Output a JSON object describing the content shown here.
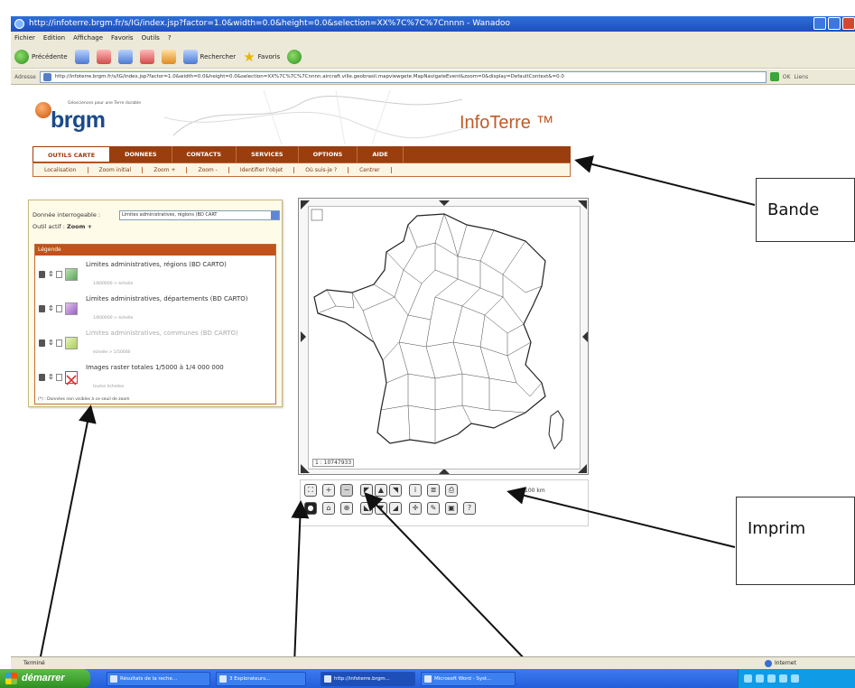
{
  "window": {
    "title": "http://infoterre.brgm.fr/s/IG/index.jsp?factor=1.0&width=0.0&height=0.0&selection=XX%7C%7C%7Cnnnn - Wanadoo"
  },
  "menubar": [
    "Fichier",
    "Edition",
    "Affichage",
    "Favoris",
    "Outils",
    "?"
  ],
  "toolbar": {
    "back_label": "Précédente",
    "search_label": "Rechercher",
    "favorites_label": "Favoris"
  },
  "address": {
    "label": "Adresse",
    "url": "http://infoterre.brgm.fr/s/IG/index.jsp?factor=1.0&width=0.0&height=0.0&selection=XX%7C%7C%7Cnnnn.aircraft.ville.geobrasil.mapviewgete.MapNavigateEvent&zoom=0&display=DefaultContext&=0.0",
    "go_label": "OK",
    "links_label": "Liens"
  },
  "site": {
    "logo_text": "brgm",
    "logo_tagline": "Géosciences pour une Terre durable",
    "headline": "InfoTerre ™"
  },
  "tabs": [
    "OUTILS CARTE",
    "DONNEES",
    "CONTACTS",
    "SERVICES",
    "OPTIONS",
    "AIDE"
  ],
  "subtabs": [
    "Localisation",
    "Zoom initial",
    "Zoom +",
    "Zoom -",
    "Identifier l'objet",
    "Où suis-je ?",
    "Centrer"
  ],
  "panel": {
    "queried_label": "Donnée interrogeable :",
    "queried_value": "Limites administratives, régions (BD CART",
    "active_tool_label": "Outil actif : ",
    "active_tool_value": "Zoom +",
    "legend_title": "Légende",
    "layers": [
      {
        "label": "Limites administratives, régions (BD CARTO)",
        "sub": "1/600000 > échelle",
        "dim": false
      },
      {
        "label": "Limites administratives, départements (BD CARTO)",
        "sub": "1/600000 > échelle",
        "dim": false
      },
      {
        "label": "Limites administratives, communes (BD CARTO)",
        "sub": "échelle > 1/50000",
        "dim": true
      },
      {
        "label": "Images raster totales 1/5000 à 1/4 000 000",
        "sub": "toutes échelles",
        "dim": false
      }
    ],
    "footer_note": "(*) : Données non visibles à ce seuil de zoom"
  },
  "map": {
    "scale_text": "1 : 10747933",
    "print_scale": "100 km"
  },
  "callouts": {
    "bandeau": "Bande",
    "imprimer": "Imprim"
  },
  "statusbar": {
    "left": "Terminé",
    "zone": "Internet"
  },
  "taskbar": {
    "start": "démarrer",
    "tasks": [
      "Résultats de la reche...",
      "3 Explorateurs...",
      "http://infoterre.brgm...",
      "Microsoft Word - Syst..."
    ]
  },
  "colors": {
    "brand": "#1b4a8a",
    "accent": "#c15a25",
    "tab_bar": "#9a3d0f"
  }
}
